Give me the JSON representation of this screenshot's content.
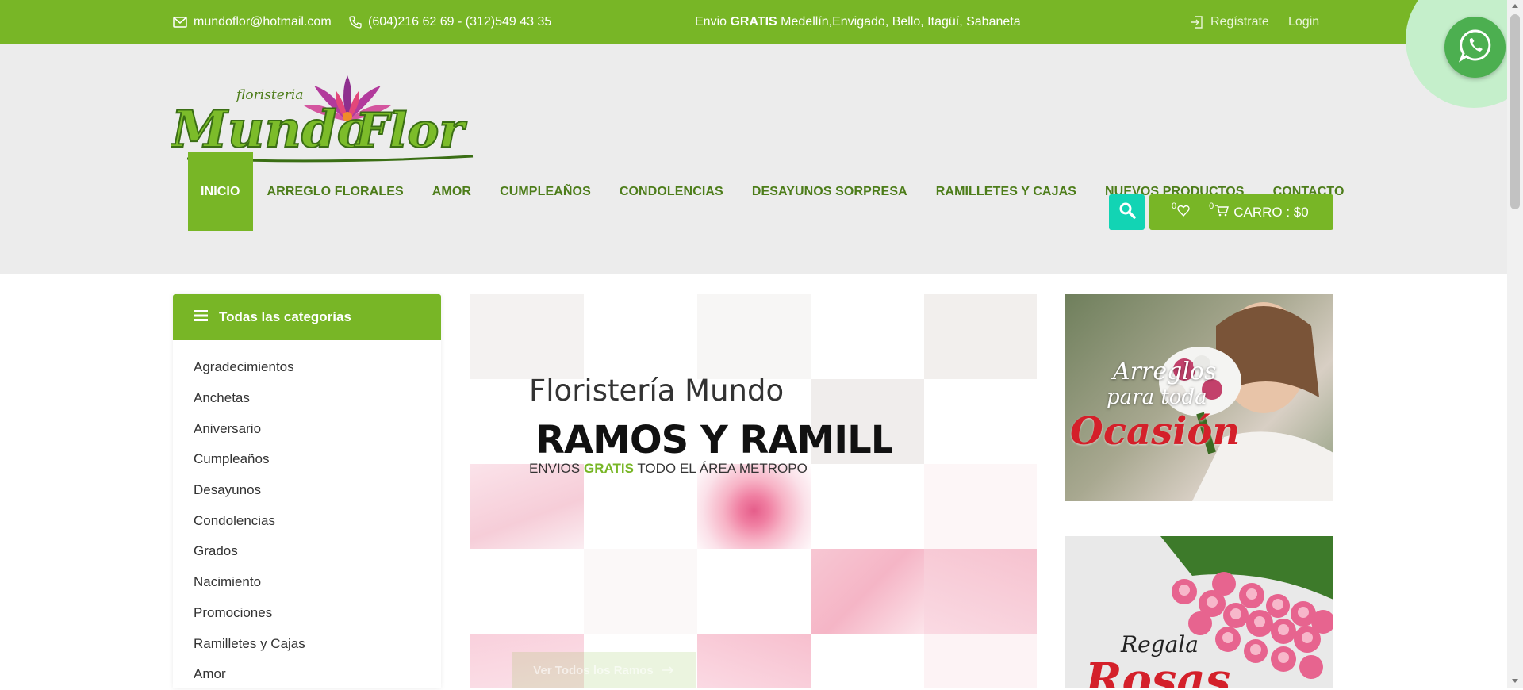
{
  "topbar": {
    "email": "mundoflor@hotmail.com",
    "phones": "(604)216 62 69 - (312)549 43 35",
    "shipping_prefix": "Envio ",
    "shipping_bold": "GRATIS",
    "shipping_suffix": " Medellín,Envigado, Bello, Itagüí, Sabaneta",
    "register": "Regístrate",
    "login": "Login"
  },
  "logo": {
    "top_text": "floristeria",
    "text_1": "Mundo",
    "text_2": "Flor"
  },
  "nav": [
    "INICIO",
    "ARREGLO FLORALES",
    "AMOR",
    "CUMPLEAÑOS",
    "CONDOLENCIAS",
    "DESAYUNOS SORPRESA",
    "RAMILLETES Y CAJAS",
    "NUEVOS PRODUCTOS",
    "CONTACTO"
  ],
  "cart": {
    "wishlist_count": "0",
    "cart_count": "0",
    "label": "CARRO : $0"
  },
  "categories": {
    "title": "Todas las categorías",
    "items": [
      "Agradecimientos",
      "Anchetas",
      "Aniversario",
      "Cumpleaños",
      "Desayunos",
      "Condolencias",
      "Grados",
      "Nacimiento",
      "Promociones",
      "Ramilletes y Cajas",
      "Amor"
    ]
  },
  "slider": {
    "subtitle": "Floristería Mundo F",
    "title": "RAMOS Y RAMILLET",
    "tag_1": "ENVIOS ",
    "tag_hl": "GRATIS",
    "tag_2": " TODO EL ÁREA METROPO",
    "button": "Ver Todos los Ramos"
  },
  "banners": {
    "b1_line1": "Arreglos",
    "b1_line2": "para toda",
    "b1_line3": "Ocasión",
    "b2_line1": "Regala",
    "b2_line2": "Rosas"
  },
  "colors": {
    "brand_green": "#78b626",
    "nav_text": "#4d7d1a",
    "search_teal": "#12d4b4",
    "whatsapp": "#4caf50"
  }
}
